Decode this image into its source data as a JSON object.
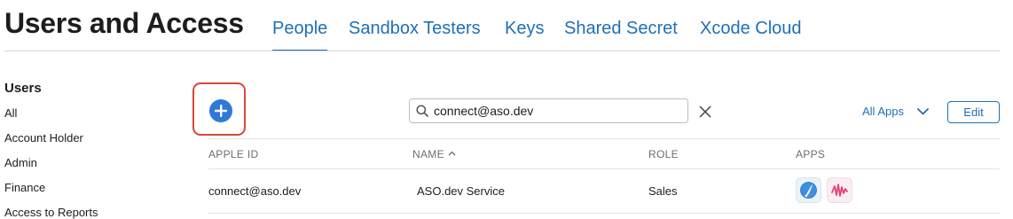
{
  "header": {
    "title": "Users and Access",
    "tabs": [
      {
        "label": "People",
        "active": true
      },
      {
        "label": "Sandbox Testers",
        "active": false
      },
      {
        "label": "Keys",
        "active": false
      },
      {
        "label": "Shared Secret",
        "active": false
      },
      {
        "label": "Xcode Cloud",
        "active": false
      }
    ]
  },
  "sidebar": {
    "heading": "Users",
    "items": [
      {
        "label": "All"
      },
      {
        "label": "Account Holder"
      },
      {
        "label": "Admin"
      },
      {
        "label": "Finance"
      },
      {
        "label": "Access to Reports"
      }
    ]
  },
  "toolbar": {
    "add_icon": "plus-circle-icon",
    "search": {
      "value": "connect@aso.dev",
      "placeholder": ""
    },
    "clear_icon": "close-icon",
    "filter_label": "All Apps",
    "edit_label": "Edit"
  },
  "table": {
    "columns": [
      "APPLE ID",
      "NAME",
      "ROLE",
      "APPS"
    ],
    "sorted_column": "NAME",
    "sort_direction": "ascending",
    "rows": [
      {
        "apple_id": "connect@aso.dev",
        "name": "ASO.dev Service",
        "role": "Sales",
        "apps": [
          "app-icon-blue-swoosh",
          "app-icon-pink-waveform"
        ]
      }
    ]
  },
  "colors": {
    "accent": "#1f6fb7",
    "add_button": "#2f78d8",
    "highlight": "#d9473a",
    "text": "#1d1d1f",
    "muted": "#6e6e73"
  }
}
